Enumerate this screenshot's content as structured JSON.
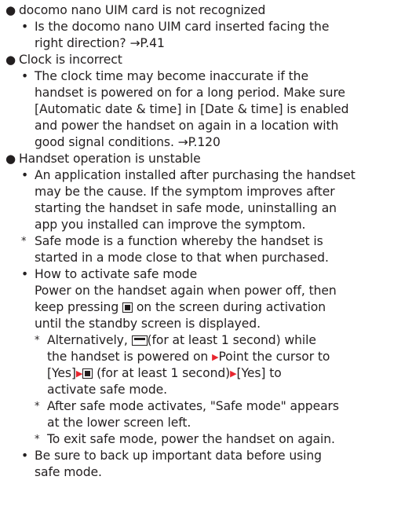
{
  "icons": {
    "section_bullet": "filled-circle-bullet",
    "sub_bullet": "small-dot-bullet",
    "home_key": "home-key-icon",
    "power_key": "power-key-icon",
    "step_arrow": "red-right-triangle-icon",
    "step_arrow_color": "#e8252e"
  },
  "sections": [
    {
      "title": "docomo nano UIM card is not recognized",
      "lines": [
        "Is the docomo nano UIM card inserted facing the",
        "right direction? →P.41"
      ]
    },
    {
      "title": "Clock is incorrect",
      "lines": [
        "The clock time may become inaccurate if the",
        "handset is powered on for a long period. Make sure",
        "[Automatic date & time] in [Date & time] is enabled",
        "and power the handset on again in a location with",
        "good signal conditions. →P.120"
      ]
    },
    {
      "title": "Handset operation is unstable",
      "cause": [
        "An application installed after purchasing the handset",
        "may be the cause. If the symptom improves after",
        "starting the handset in safe mode, uninstalling an",
        "app you installed can improve the symptom."
      ],
      "cause_note": [
        "Safe mode is a function whereby the handset is",
        "started in a mode close to that when purchased."
      ],
      "howto_title": "How to activate safe mode",
      "howto_line1": "Power on the handset again when power off, then",
      "howto_line2_a": "keep pressing",
      "howto_line2_b": "on the screen during activation",
      "howto_line3": "until the standby screen is displayed.",
      "alt_a": "Alternatively,",
      "alt_b": "(for at least 1 second) while",
      "alt_c": "the handset is powered on",
      "alt_d": "Point the cursor to",
      "alt_e": "[Yes]",
      "alt_f": "(for at least 1 second)",
      "alt_g": "[Yes] to",
      "alt_h": "activate safe mode.",
      "after": [
        "After safe mode activates, \"Safe mode\" appears",
        "at the lower screen left."
      ],
      "exit": "To exit safe mode, power the handset on again.",
      "backup": [
        "Be sure to back up important data before using",
        "safe mode."
      ]
    }
  ]
}
